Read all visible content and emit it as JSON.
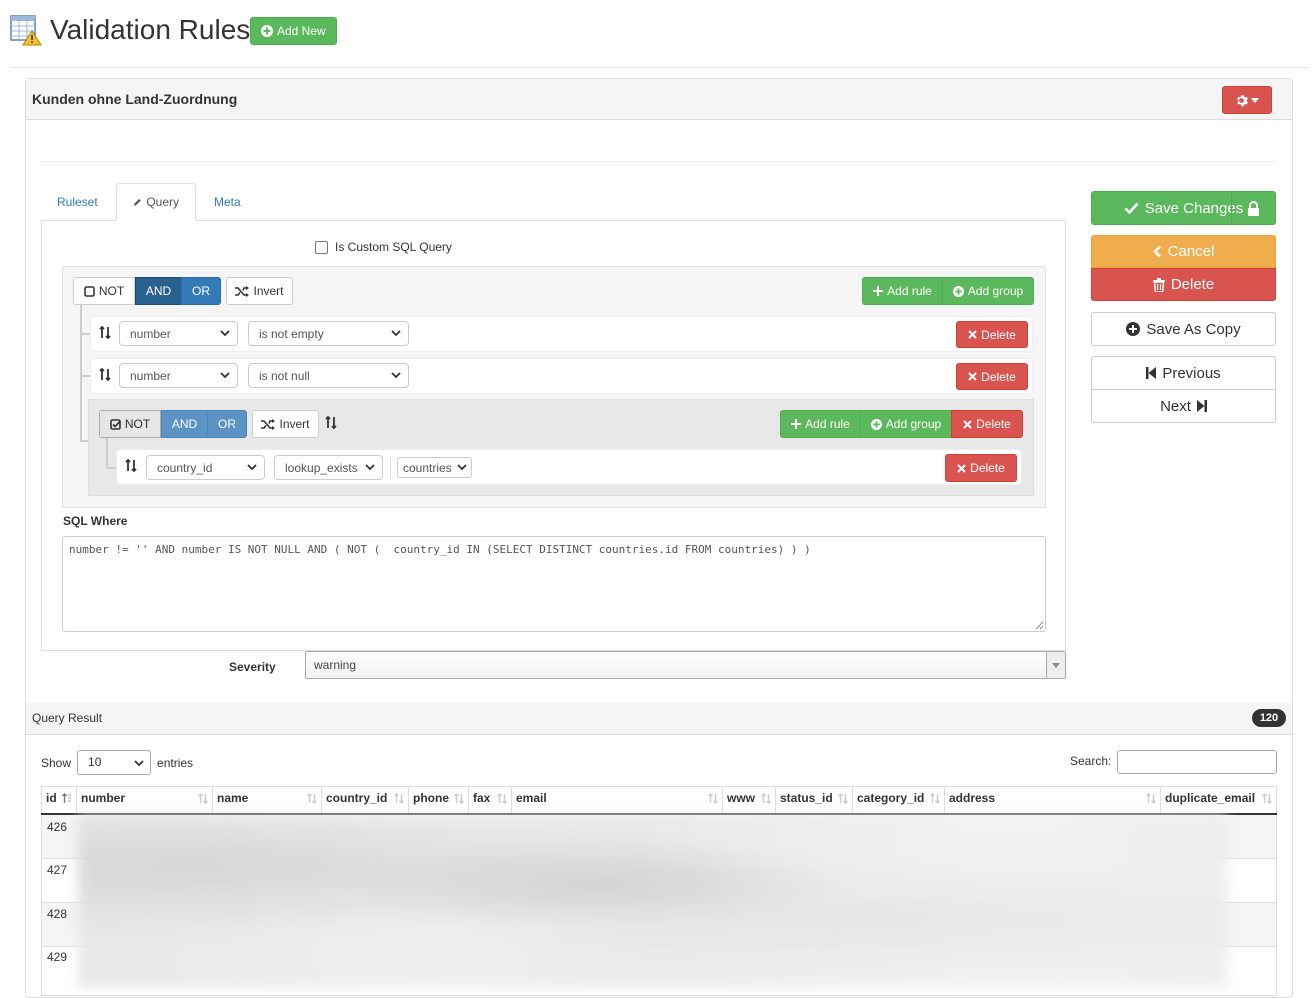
{
  "header": {
    "title": "Validation Rules",
    "add_new_label": "Add New"
  },
  "panel": {
    "title": "Kunden ohne Land-Zuordnung"
  },
  "tabs": [
    {
      "label": "Ruleset",
      "active": false
    },
    {
      "label": "Query",
      "active": true
    },
    {
      "label": "Meta",
      "active": false
    }
  ],
  "custom_sql": {
    "label": "Is Custom SQL Query",
    "checked": false
  },
  "query_builder": {
    "not_label": "NOT",
    "and_label": "AND",
    "or_label": "OR",
    "invert_label": "Invert",
    "add_rule_label": "Add rule",
    "add_group_label": "Add group",
    "delete_label": "Delete",
    "rules": [
      {
        "field": "number",
        "operator": "is not empty"
      },
      {
        "field": "number",
        "operator": "is not null"
      }
    ],
    "subgroup": {
      "not_checked": true,
      "rule": {
        "field": "country_id",
        "operator": "lookup_exists",
        "value": "countries"
      }
    }
  },
  "actions": {
    "save": "Save Changes",
    "cancel": "Cancel",
    "delete": "Delete",
    "save_copy": "Save As Copy",
    "previous": "Previous",
    "next": "Next"
  },
  "sql_where": {
    "label": "SQL Where",
    "value": "number != '' AND number IS NOT NULL AND ( NOT (  country_id IN (SELECT DISTINCT countries.id FROM countries) ) )"
  },
  "severity": {
    "label": "Severity",
    "value": "warning"
  },
  "query_result": {
    "title": "Query Result",
    "count": "120",
    "show_label": "Show",
    "entries_label": "entries",
    "page_length": "10",
    "search_label": "Search:",
    "columns": [
      "id",
      "number",
      "name",
      "country_id",
      "phone",
      "fax",
      "email",
      "www",
      "status_id",
      "category_id",
      "address",
      "duplicate_email"
    ],
    "rows": [
      "426",
      "427",
      "428",
      "429"
    ]
  },
  "colors": {
    "success": "#5cb85c",
    "danger": "#d9534f",
    "warning": "#f0ad4e",
    "primary": "#337ab7"
  }
}
